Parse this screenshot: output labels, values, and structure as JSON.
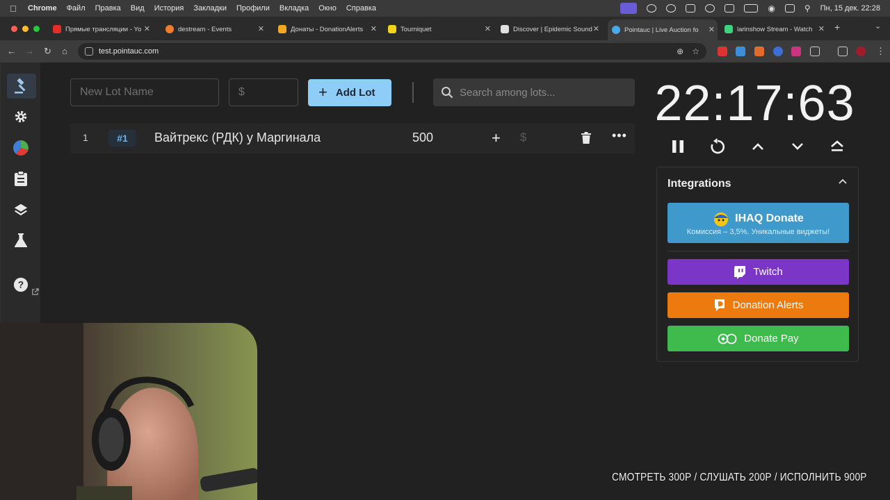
{
  "menubar": {
    "app_name": "Chrome",
    "items": [
      "Файл",
      "Правка",
      "Вид",
      "История",
      "Закладки",
      "Профили",
      "Вкладка",
      "Окно",
      "Справка"
    ],
    "clock": "Пн, 15 дек.  22:28"
  },
  "tabs": [
    {
      "title": "Прямые трансляции - Yo",
      "color": "#e52d27"
    },
    {
      "title": "destream - Events",
      "color": "#f07d2b"
    },
    {
      "title": "Донаты - DonationAlerts",
      "color": "#f5a623"
    },
    {
      "title": "Tourniquet",
      "color": "#f2d21b"
    },
    {
      "title": "Discover | Epidemic Sound",
      "color": "#e0e0e0"
    },
    {
      "title": "Pointauc | Live Auction fo",
      "color": "#4aa9e9"
    },
    {
      "title": "larinshow Stream - Watch",
      "color": "#3fd27d"
    }
  ],
  "address": {
    "url": "test.pointauc.com"
  },
  "controls": {
    "lot_name_placeholder": "New Lot Name",
    "amount_placeholder": "$",
    "add_label": "Add Lot",
    "search_placeholder": "Search among lots..."
  },
  "lots": [
    {
      "index": "1",
      "badge": "#1",
      "name": "Вайтрекс (РДК) у Маргинала",
      "amount": "500"
    }
  ],
  "timer": {
    "value": "22:17:63"
  },
  "integrations": {
    "title": "Integrations",
    "ihaq_title": "IHAQ Donate",
    "ihaq_subtitle": "Комиссия – 3,5%. Уникальные виджеты!",
    "twitch": "Twitch",
    "donation_alerts": "Donation Alerts",
    "donate_pay": "Donate Pay",
    "colors": {
      "ihaq": "#3f9acb",
      "twitch": "#7b36c7",
      "donation_alerts": "#ec7a0e",
      "donate_pay": "#3fba4d"
    }
  },
  "overlay": {
    "text": "СМОТРЕТЬ 300Р  /  СЛУШАТЬ 200Р  /  ИСПОЛНИТЬ  900Р"
  }
}
